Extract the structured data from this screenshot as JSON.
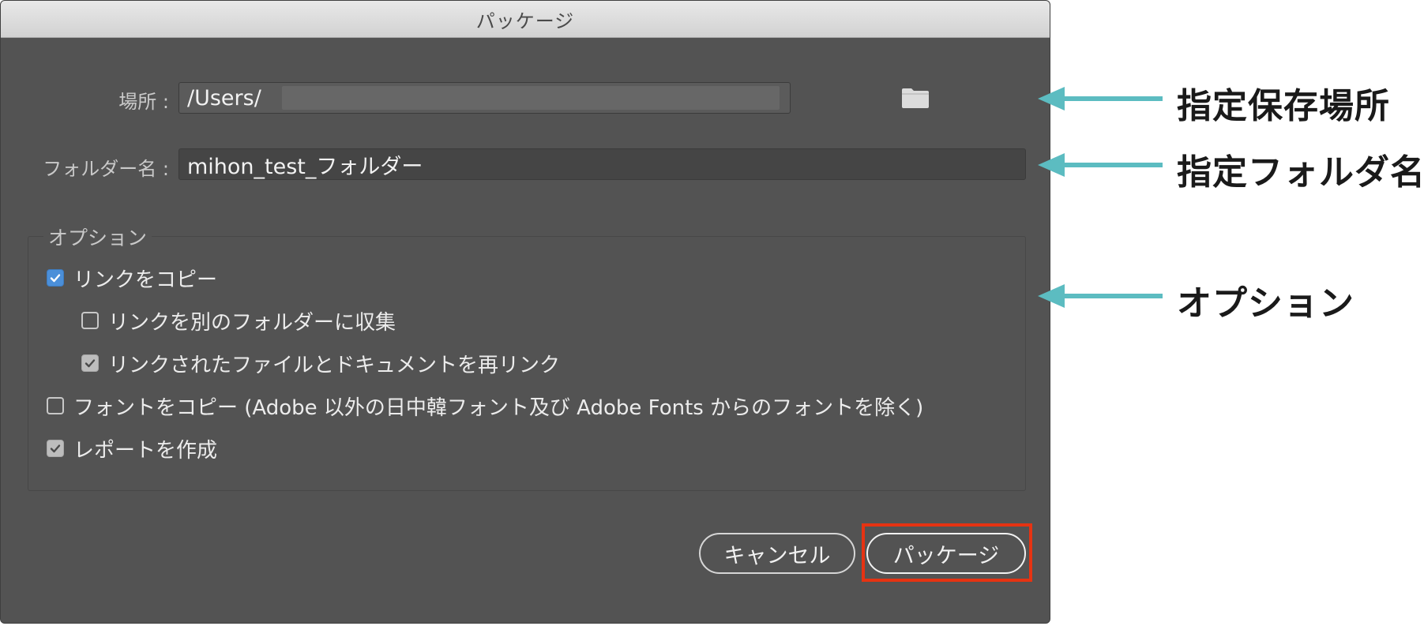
{
  "dialog": {
    "title": "パッケージ",
    "location_label": "場所 :",
    "location_value": "/Users/",
    "folder_label": "フォルダー名 :",
    "folder_value": "mihon_test_フォルダー",
    "options_legend": "オプション",
    "options": [
      {
        "label": "リンクをコピー",
        "checked": true,
        "style": "blue"
      },
      {
        "label": "リンクを別のフォルダーに収集",
        "checked": false,
        "style": "empty"
      },
      {
        "label": "リンクされたファイルとドキュメントを再リンク",
        "checked": true,
        "style": "gray"
      },
      {
        "label": "フォントをコピー (Adobe 以外の日中韓フォント及び Adobe Fonts からのフォントを除く)",
        "checked": false,
        "style": "empty"
      },
      {
        "label": "レポートを作成",
        "checked": true,
        "style": "gray"
      }
    ],
    "cancel_label": "キャンセル",
    "package_label": "パッケージ"
  },
  "annotations": {
    "location": "指定保存場所",
    "folder": "指定フォルダ名",
    "options": "オプション"
  },
  "colors": {
    "dialog_bg": "#535353",
    "arrow": "#5cbcc1",
    "highlight": "#e63312",
    "checkbox_blue": "#4b8fd9"
  },
  "icons": {
    "folder": "folder-icon",
    "check": "checkmark-icon",
    "arrow": "arrow-left-icon"
  }
}
